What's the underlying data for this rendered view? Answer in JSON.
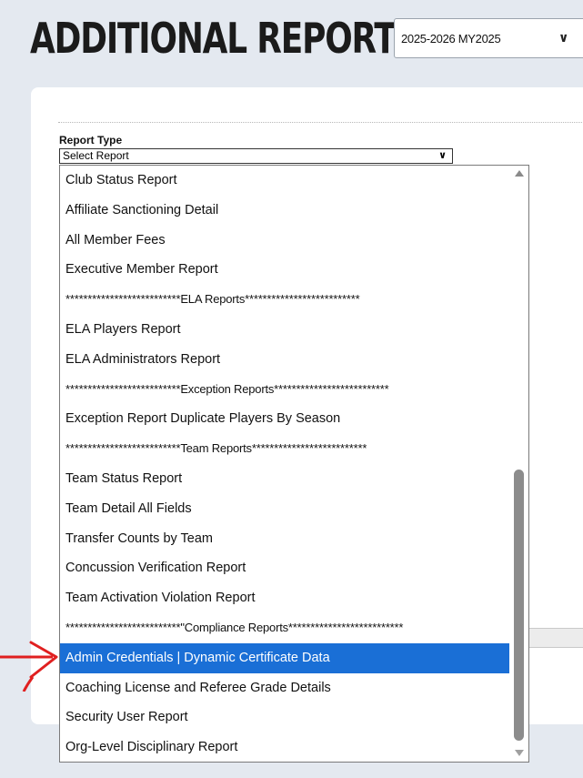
{
  "header": {
    "title": "ADDITIONAL REPORTS",
    "season_select_value": "2025-2026 MY2025"
  },
  "form": {
    "report_type_label": "Report Type",
    "report_select_value": "Select Report"
  },
  "report_options": [
    {
      "label": "Club Status Report",
      "selected": false
    },
    {
      "label": "Affiliate Sanctioning Detail",
      "selected": false
    },
    {
      "label": "All Member Fees",
      "selected": false
    },
    {
      "label": "Executive Member Report",
      "selected": false
    },
    {
      "label": "**************************ELA Reports**************************",
      "selected": false
    },
    {
      "label": "ELA Players Report",
      "selected": false
    },
    {
      "label": "ELA Administrators Report",
      "selected": false
    },
    {
      "label": "**************************Exception Reports**************************",
      "selected": false
    },
    {
      "label": "Exception Report Duplicate Players By Season",
      "selected": false
    },
    {
      "label": "**************************Team Reports**************************",
      "selected": false
    },
    {
      "label": "Team Status Report",
      "selected": false
    },
    {
      "label": "Team Detail All Fields",
      "selected": false
    },
    {
      "label": "Transfer Counts by Team",
      "selected": false
    },
    {
      "label": "Concussion Verification Report",
      "selected": false
    },
    {
      "label": "Team Activation Violation Report",
      "selected": false
    },
    {
      "label": "**************************\"Compliance Reports**************************",
      "selected": false
    },
    {
      "label": "Admin Credentials | Dynamic Certificate Data",
      "selected": true
    },
    {
      "label": "Coaching License and Referee Grade Details",
      "selected": false
    },
    {
      "label": "Security User Report",
      "selected": false
    },
    {
      "label": "Org-Level Disciplinary Report",
      "selected": false
    }
  ],
  "colors": {
    "selected_option_bg": "#1a6fd6",
    "page_bg": "#e4e9f0",
    "annotation_arrow": "#e02020"
  },
  "icons": {
    "season_dropdown": "chevron-down-icon",
    "report_dropdown": "chevron-down-icon",
    "scroll_up": "triangle-up-icon",
    "scroll_down": "triangle-down-icon",
    "annotation": "red-arrow-icon"
  }
}
